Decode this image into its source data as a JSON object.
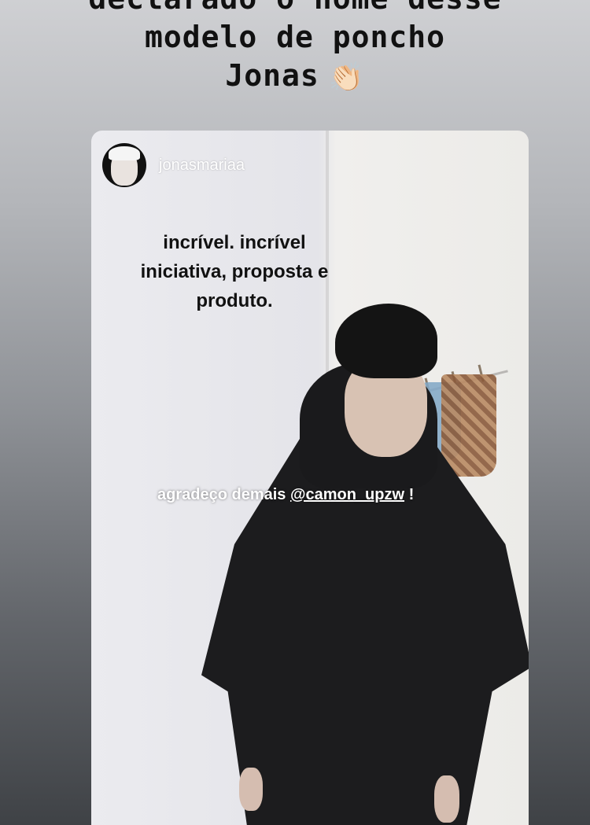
{
  "caption": {
    "line1": "declarado o nome desse",
    "line2": "modelo de poncho",
    "line3": "Jonas",
    "emoji": "👏🏻"
  },
  "story": {
    "username": "jonasmariaa",
    "sticker_lines": [
      "incrível. incrível",
      "iniciativa, proposta e",
      "produto."
    ],
    "tag_prefix": "agradeço demais ",
    "mention": "@camon_upzw",
    "tag_suffix": " !"
  }
}
